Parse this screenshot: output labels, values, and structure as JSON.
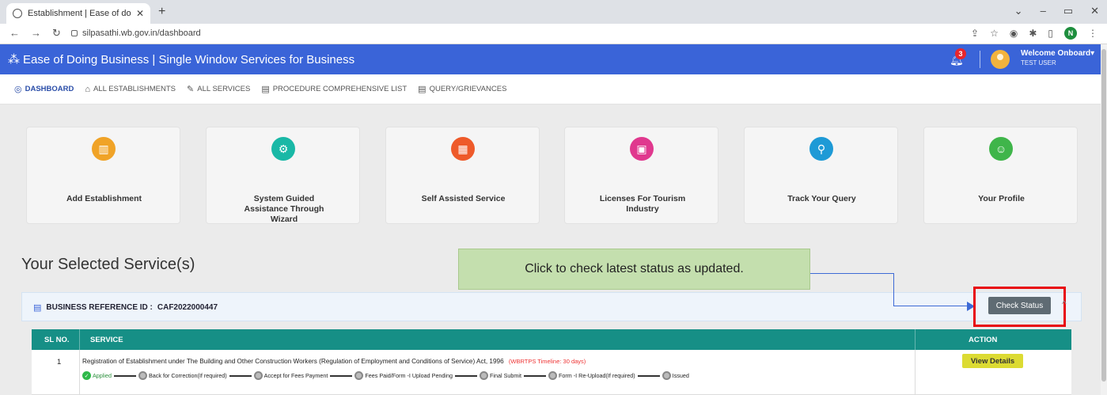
{
  "browser": {
    "tab_title": "Establishment | Ease of doing bu",
    "url": "silpasathi.wb.gov.in/dashboard",
    "profile_initial": "N"
  },
  "header": {
    "brand": "Ease of Doing Business | Single Window Services for Business",
    "notification_count": "3",
    "welcome": "Welcome Onboard",
    "user": "TEST USER",
    "bar_color": "#3a64d8"
  },
  "menu": [
    {
      "label": "DASHBOARD",
      "icon": "dashboard-icon",
      "active": true
    },
    {
      "label": "ALL ESTABLISHMENTS",
      "icon": "building-icon",
      "active": false
    },
    {
      "label": "ALL SERVICES",
      "icon": "wrench-icon",
      "active": false
    },
    {
      "label": "PROCEDURE COMPREHENSIVE LIST",
      "icon": "list-icon",
      "active": false
    },
    {
      "label": "QUERY/GRIEVANCES",
      "icon": "list-icon",
      "active": false
    }
  ],
  "cards": [
    {
      "label": "Add Establishment",
      "icon": "building-icon",
      "color": "#f0a327"
    },
    {
      "label": "System Guided Assistance Through Wizard",
      "icon": "gear-icon",
      "color": "#19b8a6"
    },
    {
      "label": "Self Assisted Service",
      "icon": "grid-icon",
      "color": "#ee5a2a"
    },
    {
      "label": "Licenses For Tourism Industry",
      "icon": "id-card-icon",
      "color": "#e0388e"
    },
    {
      "label": "Track Your Query",
      "icon": "search-icon",
      "color": "#1e9ad6"
    },
    {
      "label": "Your Profile",
      "icon": "user-icon",
      "color": "#3fb54a"
    }
  ],
  "section_title": "Your Selected Service(s)",
  "tooltip": "Click to check latest status as updated.",
  "reference": {
    "label": "BUSINESS REFERENCE ID :",
    "id": "CAF2022000447",
    "check_status": "Check Status"
  },
  "table": {
    "headers": [
      "SL NO.",
      "SERVICE",
      "ACTION"
    ],
    "header_color": "#168f86",
    "rows": [
      {
        "sl": "1",
        "service": "Registration of Establishment under The Building and Other Construction Workers (Regulation of Employment and Conditions of Service) Act, 1996",
        "timeline": "(WBRTPS Timeline: 30 days)",
        "action": "View Details",
        "steps": [
          "Applied",
          "Back for Correction(If required)",
          "Accept for Fees Payment",
          "Fees Paid/Form -I Upload Pending",
          "Final Submit",
          "Form -I Re-Upload(If required)",
          "Issued"
        ]
      }
    ]
  }
}
